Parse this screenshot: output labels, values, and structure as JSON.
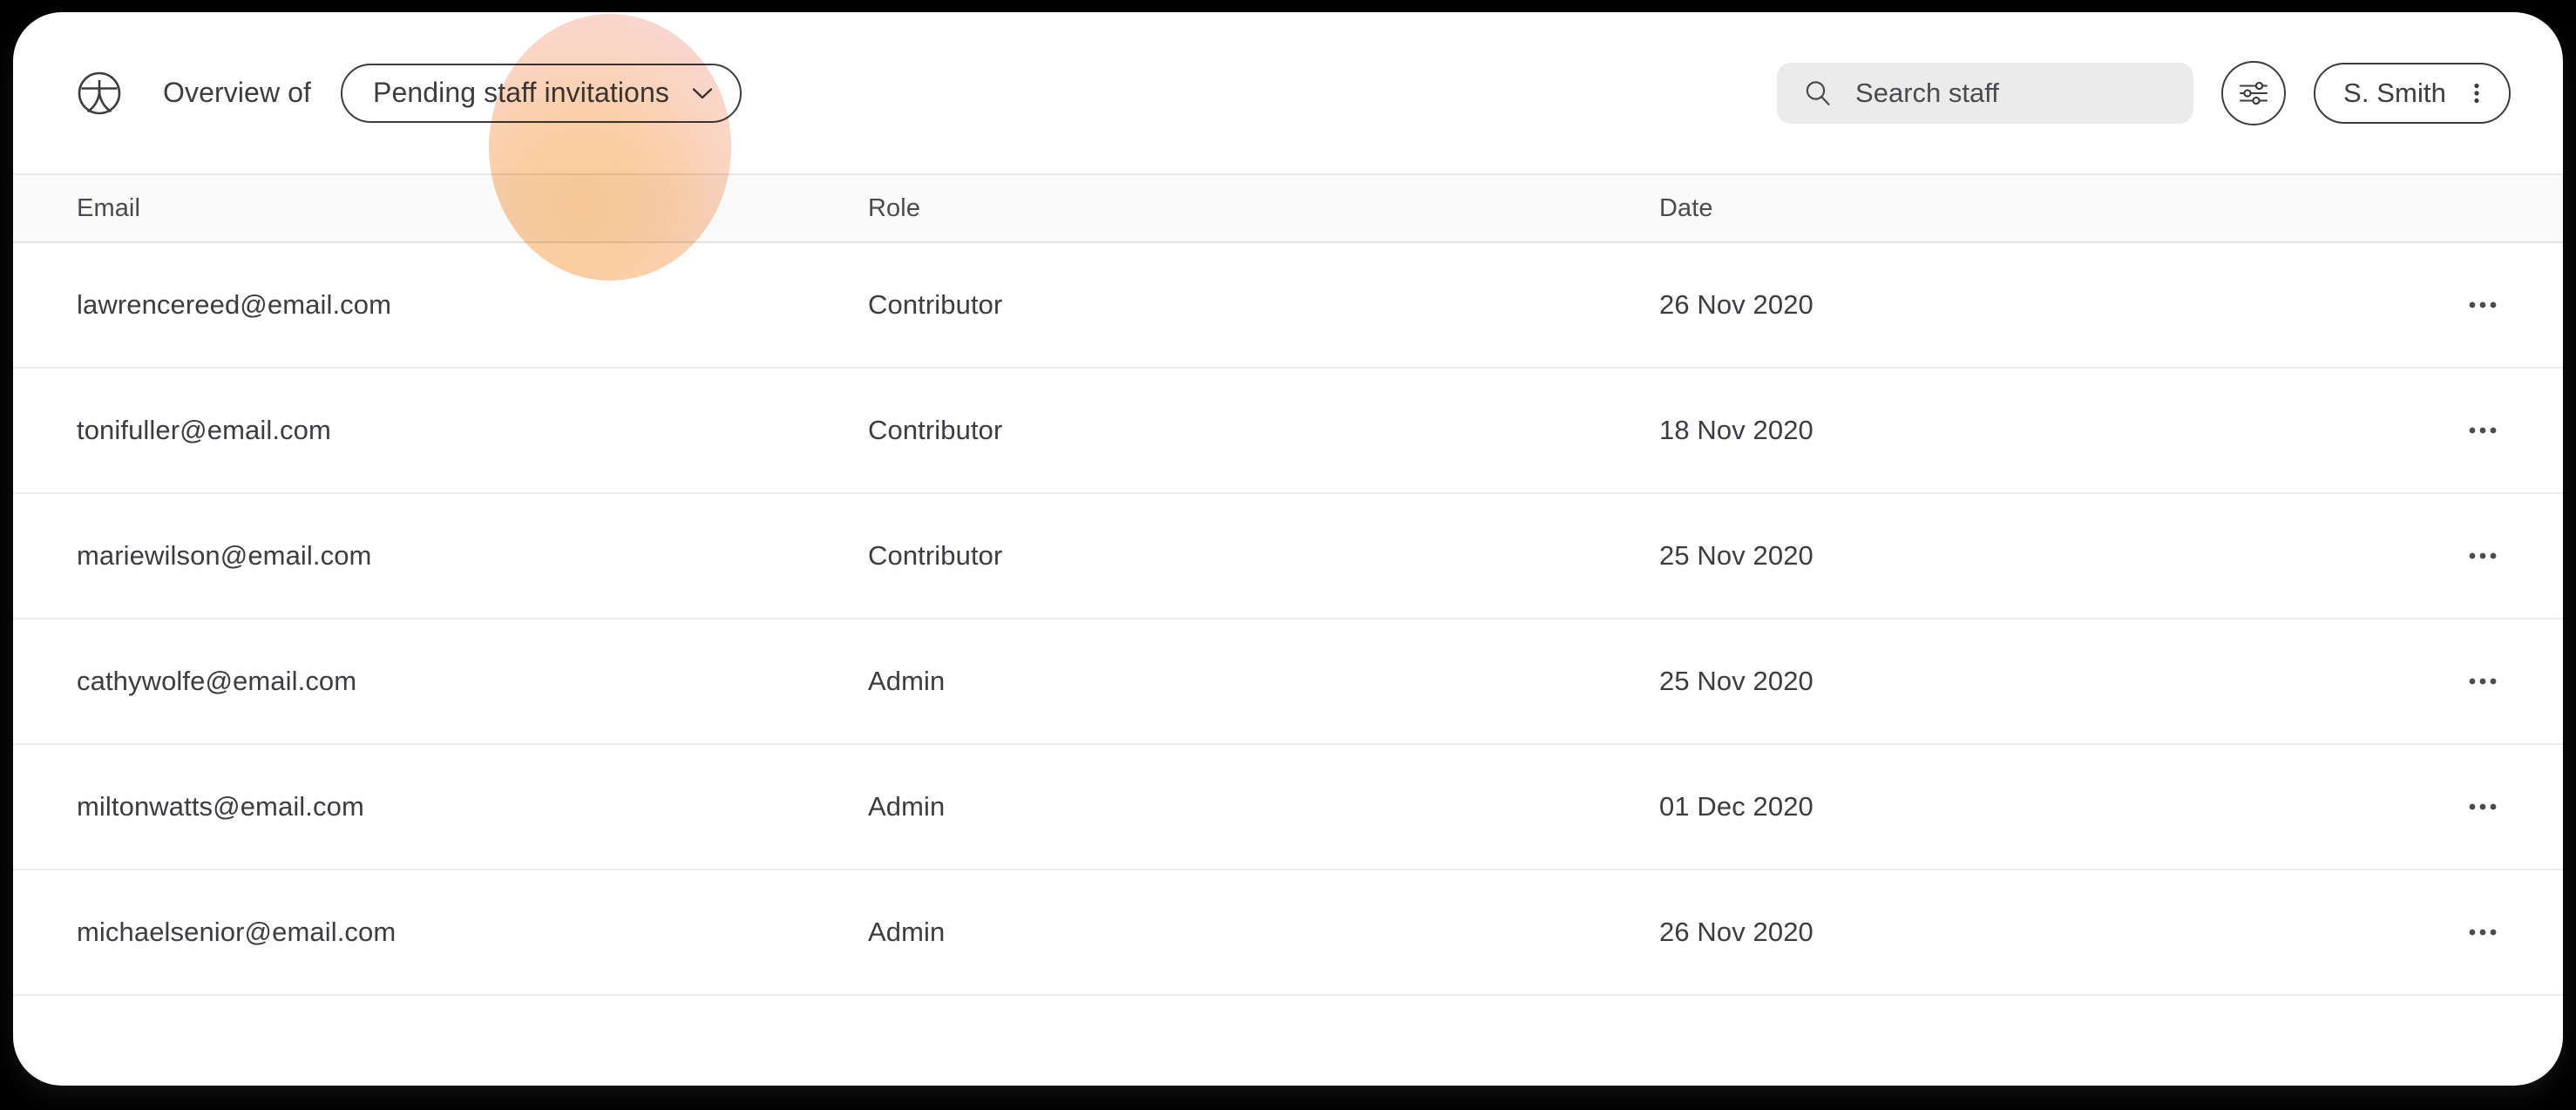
{
  "app": {
    "logo_icon": "person-in-circle-logo-icon",
    "background_color": "#000000",
    "card_color": "#ffffff",
    "text_color": "#3c3d41",
    "highlight_color": "#f9c98e"
  },
  "toolbar": {
    "overview_label": "Overview of",
    "filter_dropdown": {
      "value": "Pending staff invitations",
      "chevron_icon": "chevron-down-icon"
    },
    "search": {
      "placeholder": "Search staff",
      "value": "",
      "icon": "search-icon"
    },
    "settings_button": {
      "icon": "filter-sliders-icon",
      "label": ""
    },
    "user_menu": {
      "name": "S. Smith",
      "icon": "kebab-vertical-icon"
    }
  },
  "table": {
    "columns": [
      {
        "key": "email",
        "label": "Email"
      },
      {
        "key": "role",
        "label": "Role"
      },
      {
        "key": "date",
        "label": "Date"
      }
    ],
    "row_action_icon": "kebab-horizontal-icon",
    "rows": [
      {
        "email": "lawrencereed@email.com",
        "role": "Contributor",
        "date": "26 Nov 2020"
      },
      {
        "email": "tonifuller@email.com",
        "role": "Contributor",
        "date": "18 Nov 2020"
      },
      {
        "email": "mariewilson@email.com",
        "role": "Contributor",
        "date": "25 Nov 2020"
      },
      {
        "email": "cathywolfe@email.com",
        "role": "Admin",
        "date": "25 Nov 2020"
      },
      {
        "email": "miltonwatts@email.com",
        "role": "Admin",
        "date": "01 Dec 2020"
      },
      {
        "email": "michaelsenior@email.com",
        "role": "Admin",
        "date": "26 Nov 2020"
      }
    ]
  }
}
